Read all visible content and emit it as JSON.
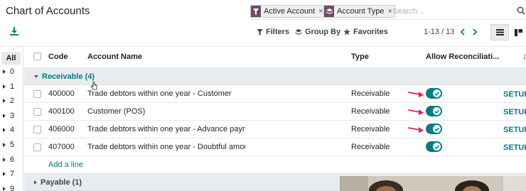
{
  "page": {
    "title": "Chart of Accounts"
  },
  "search": {
    "facets": [
      {
        "label": "Active Account",
        "icon": "filter-icon"
      },
      {
        "label": "Account Type",
        "icon": "layers-icon"
      }
    ],
    "placeholder": "Search...",
    "value": ""
  },
  "toolbar": {
    "filters_label": "Filters",
    "groupby_label": "Group By",
    "favorites_label": "Favorites",
    "pager": "1-13 / 13"
  },
  "sidebar": {
    "all_label": "All",
    "items": [
      "0",
      "1",
      "2",
      "3",
      "4",
      "5",
      "6",
      "7",
      "9"
    ]
  },
  "table": {
    "headers": {
      "code": "Code",
      "name": "Account Name",
      "type": "Type",
      "reconcile": "Allow Reconciliati..."
    },
    "groups": [
      {
        "label": "Receivable (4)",
        "expanded": true,
        "rows": [
          {
            "code": "400000",
            "name": "Trade debtors within one year - Customer",
            "type": "Receivable",
            "reconcile": true,
            "action": "SETUP"
          },
          {
            "code": "400100",
            "name": "Customer (POS)",
            "type": "Receivable",
            "reconcile": true,
            "action": "SETUP"
          },
          {
            "code": "406000",
            "name": "Trade debtors within one year - Advance payments",
            "type": "Receivable",
            "reconcile": true,
            "action": "SETUP"
          },
          {
            "code": "407000",
            "name": "Trade debtors within one year - Doubtful amounts",
            "type": "Receivable",
            "reconcile": true,
            "action": "SETUP"
          }
        ],
        "add_line": "Add a line"
      },
      {
        "label": "Payable (1)",
        "expanded": false
      }
    ]
  },
  "colors": {
    "brand": "#714b67",
    "accent": "#017e84",
    "arrow": "#e8205a"
  }
}
